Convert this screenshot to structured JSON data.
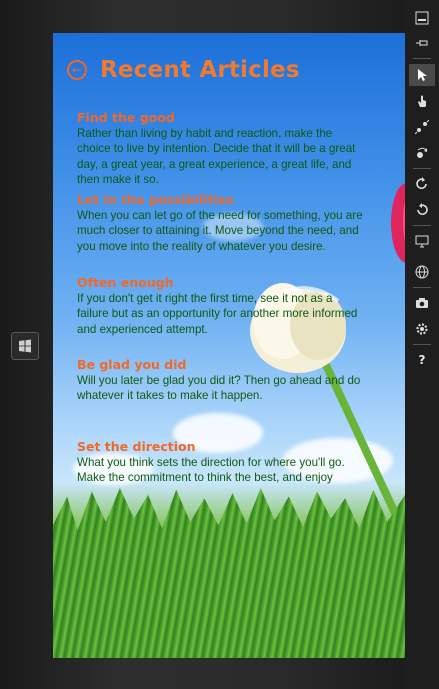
{
  "app": {
    "page_title": "Recent Articles"
  },
  "articles": [
    {
      "title": "Find the good",
      "body": "Rather than living by habit and reaction, make the choice to live by intention. Decide that it will be a great day, a great year, a great experience, a great life, and then make it so."
    },
    {
      "title": "Let in the possibilities",
      "body": "When you can let go of the need for something, you are much closer to attaining it. Move beyond the need, and you move into the reality of whatever you desire."
    },
    {
      "title": "Often enough",
      "body": "If you don't get it right the first time, see it not as a failure but as an opportunity for another more informed and experienced attempt."
    },
    {
      "title": "Be glad you did",
      "body": "Will you later be glad you did it? Then go ahead and do whatever it takes to make it happen."
    },
    {
      "title": "Set the direction",
      "body": "What you think sets the direction for where you'll go. Make the commitment to think the best, and enjoy"
    }
  ],
  "toolbar": {
    "items": [
      "minimize-icon",
      "pin-icon",
      "pointer-icon",
      "touch-icon",
      "pinch-icon",
      "rotate-gesture-icon",
      "rotate-clockwise-icon",
      "rotate-counterclockwise-icon",
      "resolution-icon",
      "location-icon",
      "screenshot-icon",
      "settings-icon",
      "help-icon"
    ],
    "help_label": "?"
  },
  "colors": {
    "title": "#f07a30",
    "article_title": "#f0692a",
    "article_body": "#0e5a12"
  }
}
